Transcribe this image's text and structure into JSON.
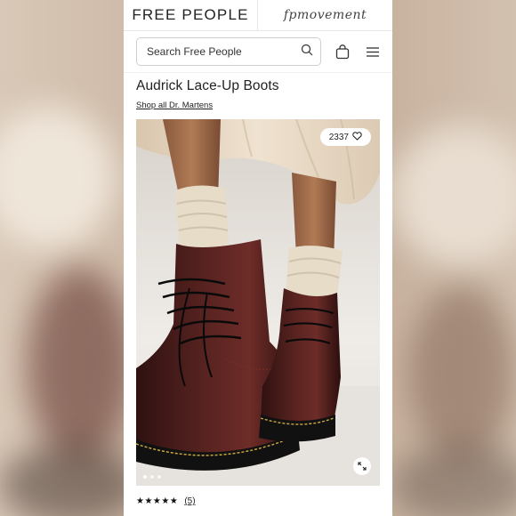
{
  "header": {
    "brand": "FREE PEOPLE",
    "secondary_brand": "fpmovement"
  },
  "search": {
    "placeholder": "Search Free People",
    "value": ""
  },
  "icons": {
    "search": "search-icon",
    "bag": "shopping-bag-icon",
    "menu": "hamburger-menu-icon",
    "heart": "heart-icon",
    "expand": "expand-icon"
  },
  "product": {
    "title": "Audrick Lace-Up Boots",
    "brand_link": "Shop all Dr. Martens",
    "likes": "2337",
    "rating_stars": "★★★★★",
    "review_count": "(5)",
    "gallery_total": 3,
    "gallery_active": 1
  },
  "colors": {
    "boot": "#4a1f1c",
    "sock": "#e6dcc8",
    "skirt": "#e2d2bd"
  }
}
